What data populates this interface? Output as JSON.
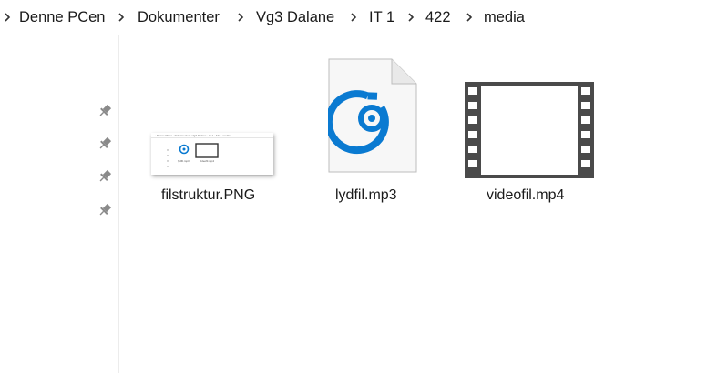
{
  "breadcrumb": {
    "items": [
      "Denne PCen",
      "Dokumenter",
      "Vg3 Dalane",
      "IT 1",
      "422",
      "media"
    ]
  },
  "files": [
    {
      "name": "filstruktur.PNG",
      "icon": "image-thumbnail-icon"
    },
    {
      "name": "lydfil.mp3",
      "icon": "audio-file-icon"
    },
    {
      "name": "videofil.mp4",
      "icon": "video-file-icon"
    }
  ],
  "thumbnail": {
    "crumb": "› Denne PCen › Dokumenter › Vg3 Dalane › IT 1 › 422 › media",
    "audio_label": "lydfil.mp3",
    "video_label": "videofil.mp4"
  },
  "colors": {
    "accent": "#0a7ad1",
    "film": "#4a4a4a"
  }
}
